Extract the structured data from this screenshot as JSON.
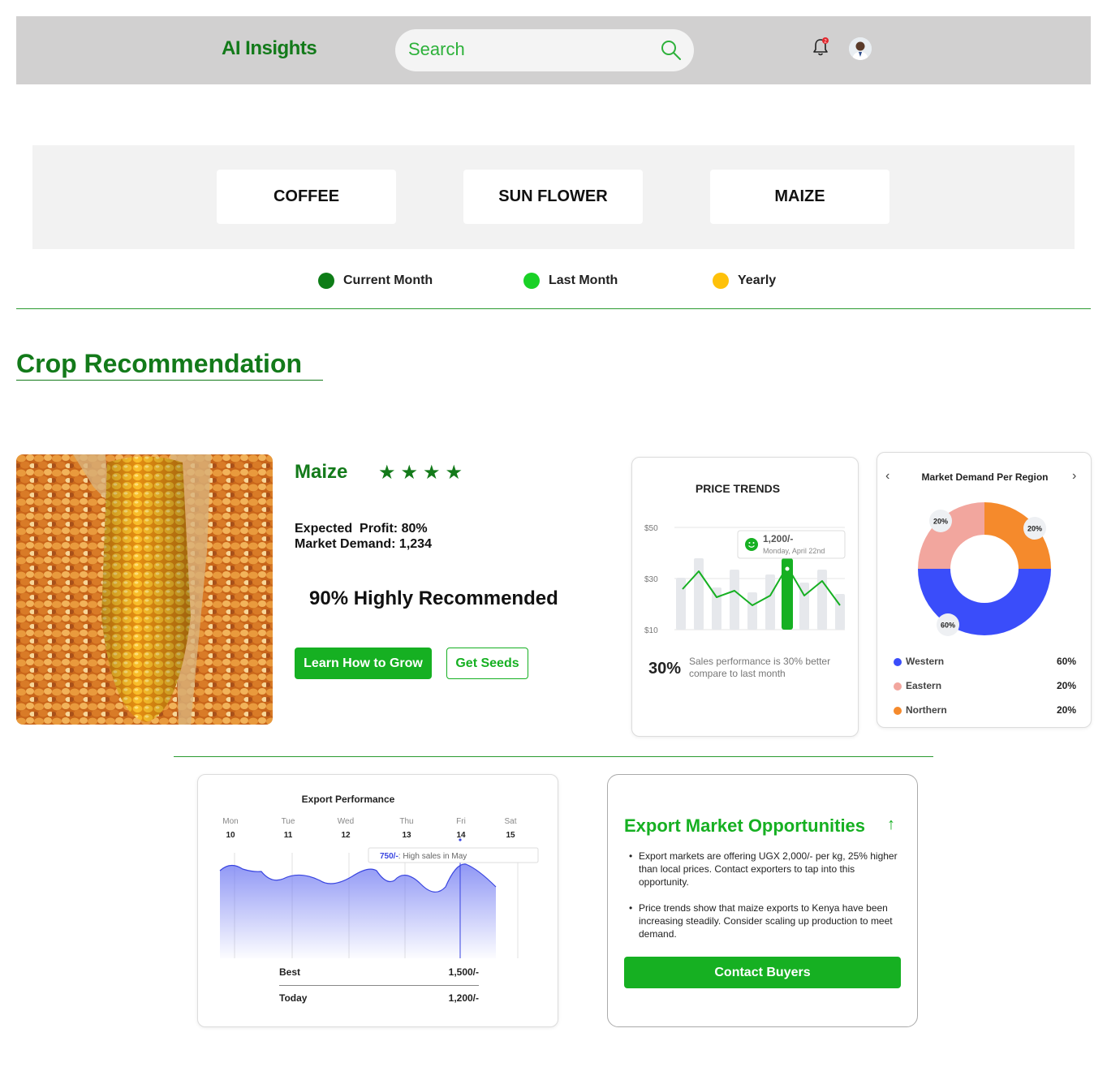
{
  "header": {
    "brand": "AI Insights",
    "search_placeholder": "Search",
    "notification_count": "2"
  },
  "crop_tabs": [
    "COFFEE",
    "SUN FLOWER",
    "MAIZE"
  ],
  "legend": [
    {
      "label": "Current Month",
      "color": "#0e7d17"
    },
    {
      "label": "Last Month",
      "color": "#19d126"
    },
    {
      "label": "Yearly",
      "color": "#fec10a"
    }
  ],
  "section_title": "Crop Recommendation",
  "recommendation": {
    "crop": "Maize",
    "rating": 4,
    "stars": "★★★★",
    "expected_profit": "Expected  Profit: 80%",
    "market_demand": "Market Demand: 1,234",
    "recommendation_text": "90% Highly Recommended",
    "learn_button": "Learn How to Grow",
    "seeds_button": "Get Seeds"
  },
  "price_trends": {
    "title": "PRICE TRENDS",
    "y_ticks": [
      "$50",
      "$30",
      "$10"
    ],
    "tooltip_value": "1,200/-",
    "tooltip_date": "Monday, April 22nd",
    "performance_value": "30%",
    "performance_text": "Sales performance is 30% better compare to last month",
    "accent_color": "#16b022"
  },
  "market_demand": {
    "title": "Market Demand Per Region",
    "regions": [
      {
        "name": "Western",
        "value": "60%",
        "color": "#3a4dfa"
      },
      {
        "name": "Eastern",
        "value": "20%",
        "color": "#f2a69e"
      },
      {
        "name": "Northern",
        "value": "20%",
        "color": "#f58a2c"
      }
    ]
  },
  "export_performance": {
    "title": "Export Performance",
    "days": [
      {
        "day": "Mon",
        "date": "10"
      },
      {
        "day": "Tue",
        "date": "11"
      },
      {
        "day": "Wed",
        "date": "12"
      },
      {
        "day": "Thu",
        "date": "13"
      },
      {
        "day": "Fri",
        "date": "14"
      },
      {
        "day": "Sat",
        "date": "15"
      }
    ],
    "tooltip_value": "750/-",
    "tooltip_text": ": High sales in May",
    "best_label": "Best",
    "best_value": "1,500/-",
    "today_label": "Today",
    "today_value": "1,200/-"
  },
  "opportunities": {
    "title": "Export Market Opportunities",
    "items": [
      "Export markets are offering UGX 2,000/- per kg, 25% higher than local prices. Contact exporters to tap into this opportunity.",
      "Price trends show that maize exports to Kenya have been increasing steadily. Consider scaling up production to meet demand."
    ],
    "button": "Contact Buyers"
  }
}
